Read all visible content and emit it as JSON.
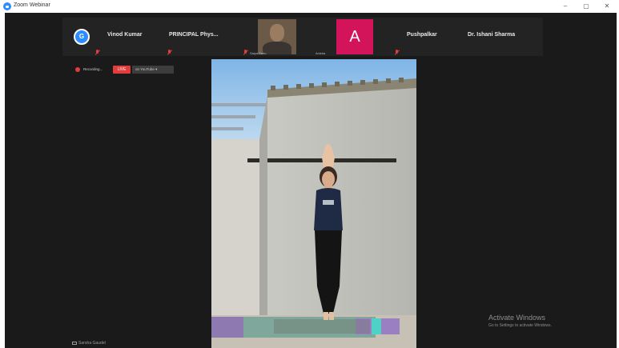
{
  "window": {
    "title": "Zoom Webinar",
    "minimize": "–",
    "maximize": "▢",
    "close": "✕"
  },
  "participants": {
    "avatar_initial": "G",
    "p1_name": "Vinod Kumar",
    "p2_name": "PRINCIPAL Phys...",
    "p3_caption": "Saiya Sahu",
    "p4_letter": "A",
    "p4_caption": "Anisha",
    "p5_name": "Pushpalkar",
    "p6_name": "Dr. Ishani Sharma"
  },
  "recording": {
    "status": "Recording...",
    "live_label": "LIVE",
    "live_menu": "on YouTube ▾"
  },
  "watermark": {
    "line1": "Activate Windows",
    "line2": "Go to Settings to activate Windows."
  },
  "bottom": {
    "label": "Sandra Gaudet"
  },
  "colors": {
    "meeting_bg": "#1a1a1a",
    "zoom_blue": "#2d8cff",
    "avatar_pink": "#d4145a",
    "recording_red": "#e23c3c"
  },
  "icons": [
    "zoom-logo-icon",
    "mic-muted-icon",
    "recording-dot-icon",
    "screen-share-icon"
  ]
}
